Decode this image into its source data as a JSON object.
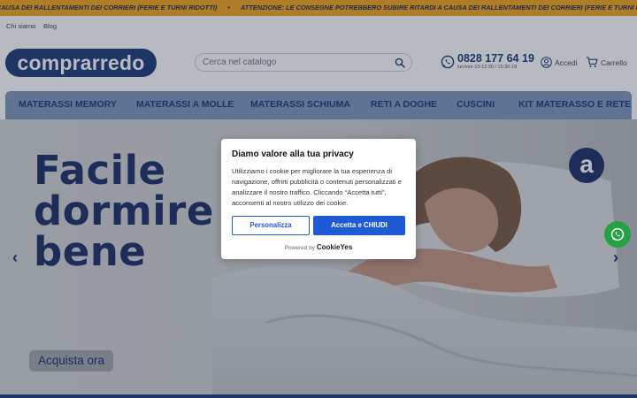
{
  "ticker": {
    "segments": [
      "CAUSA DEI RALLENTAMENTI DEI CORRIERI (FERIE E TURNI RIDOTTI)",
      "ATTENZIONE: LE CONSEGNE POTREBBERO SUBIRE RITARDI A CAUSA DEI RALLENTAMENTI DEI CORRIERI (FERIE E TURNI RIDOTTI)"
    ],
    "separator": "•"
  },
  "toplinks": [
    "Chi siamo",
    "Blog"
  ],
  "header": {
    "logo_text": "comprarredo",
    "search_placeholder": "Cerca nel catalogo",
    "phone_number": "0828 177 64 19",
    "phone_hours": "lun/ven 10-12:30 / 15:30-18",
    "login_label": "Accedi",
    "cart_label": "Carrello"
  },
  "nav": [
    "MATERASSI MEMORY",
    "MATERASSI A MOLLE",
    "MATERASSI SCHIUMA",
    "RETI A DOGHE",
    "CUSCINI",
    "KIT MATERASSO E RETE"
  ],
  "hero": {
    "title_lines": [
      "Facile",
      "dormire",
      "bene"
    ],
    "cta_label": "Acquista ora",
    "badge_letter": "a",
    "arrow_left": "‹",
    "arrow_right": "›"
  },
  "cookie": {
    "title": "Diamo valore alla tua privacy",
    "text": "Utilizziamo i cookie per migliorare la tua esperienza di navigazione, offrirti pubblicità o contenuti personalizzati e analizzare il nostro traffico. Cliccando “Accetta tutti”, acconsenti al nostro utilizzo dei cookie.",
    "customize_label": "Personalizza",
    "accept_label": "Accetta e CHIUDI",
    "powered_prefix": "Powered by",
    "powered_brand": "CookieYes"
  },
  "colors": {
    "brand": "#1d3b78",
    "ticker": "#f3a51e",
    "accept": "#1f5ad6",
    "whatsapp": "#25a244"
  }
}
